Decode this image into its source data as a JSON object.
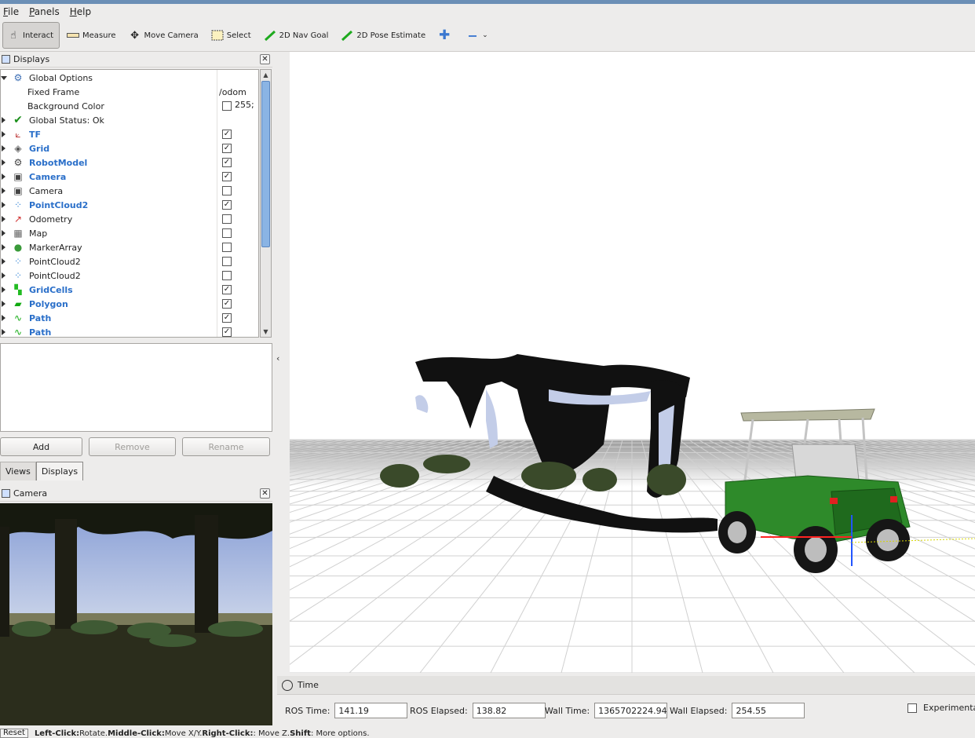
{
  "menu": [
    "File",
    "Panels",
    "Help"
  ],
  "toolbar": {
    "interact": "Interact",
    "measure": "Measure",
    "move_camera": "Move Camera",
    "select": "Select",
    "nav_goal": "2D Nav Goal",
    "pose_estimate": "2D Pose Estimate"
  },
  "displays_panel": {
    "title": "Displays",
    "global_options": "Global Options",
    "fixed_frame_label": "Fixed Frame",
    "fixed_frame_value": "/odom",
    "background_color_label": "Background Color",
    "background_color_value": "255;",
    "global_status": "Global Status: Ok",
    "items": [
      {
        "label": "TF",
        "checked": true,
        "icon": "tf-icon"
      },
      {
        "label": "Grid",
        "checked": true,
        "icon": "grid-icon"
      },
      {
        "label": "RobotModel",
        "checked": true,
        "icon": "robot-model-icon"
      },
      {
        "label": "Camera",
        "checked": true,
        "icon": "camera-icon"
      },
      {
        "label": "Camera",
        "checked": false,
        "icon": "camera-icon"
      },
      {
        "label": "PointCloud2",
        "checked": true,
        "icon": "point-cloud-icon"
      },
      {
        "label": "Odometry",
        "checked": false,
        "icon": "odometry-icon"
      },
      {
        "label": "Map",
        "checked": false,
        "icon": "map-icon"
      },
      {
        "label": "MarkerArray",
        "checked": false,
        "icon": "marker-array-icon"
      },
      {
        "label": "PointCloud2",
        "checked": false,
        "icon": "point-cloud-icon"
      },
      {
        "label": "PointCloud2",
        "checked": false,
        "icon": "point-cloud-icon"
      },
      {
        "label": "GridCells",
        "checked": true,
        "icon": "grid-cells-icon"
      },
      {
        "label": "Polygon",
        "checked": true,
        "icon": "polygon-icon"
      },
      {
        "label": "Path",
        "checked": true,
        "icon": "path-icon"
      },
      {
        "label": "Path",
        "checked": true,
        "icon": "path-icon"
      }
    ],
    "add_button": "Add",
    "remove_button": "Remove",
    "rename_button": "Rename",
    "tabs": [
      "Views",
      "Displays"
    ]
  },
  "camera_panel": {
    "title": "Camera"
  },
  "time_panel": {
    "title": "Time",
    "ros_time_label": "ROS Time:",
    "ros_time": "141.19",
    "ros_elapsed_label": "ROS Elapsed:",
    "ros_elapsed": "138.82",
    "wall_time_label": "Wall Time:",
    "wall_time": "1365702224.94",
    "wall_elapsed_label": "Wall Elapsed:",
    "wall_elapsed": "254.55",
    "experimental_label": "Experimental"
  },
  "status": {
    "reset": "Reset",
    "left_click": "Left-Click:",
    "left_action": " Rotate. ",
    "middle_click": "Middle-Click:",
    "middle_action": " Move X/Y. ",
    "right_click": "Right-Click:",
    "right_action": ": Move Z. ",
    "shift": "Shift",
    "shift_action": ": More options."
  },
  "colors": {
    "enabled_display": "#2a6fc9",
    "scroll_thumb": "#8ab4e4",
    "cart_body": "#2e8a2a"
  }
}
